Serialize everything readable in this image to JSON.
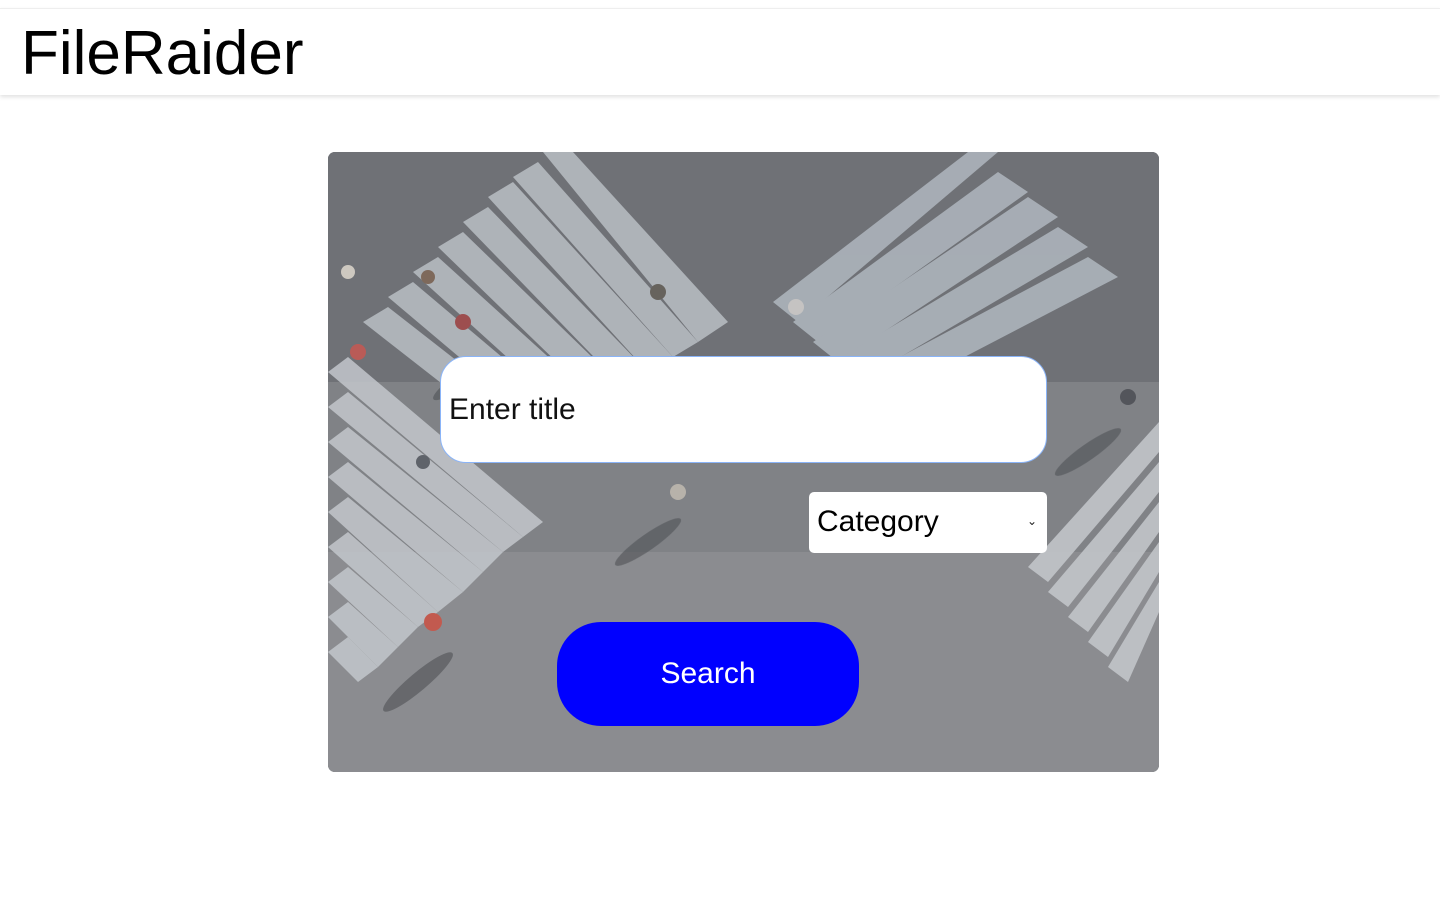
{
  "app": {
    "brand": "FileRaider"
  },
  "search": {
    "title_placeholder": "Enter title",
    "title_value": "",
    "category_label": "Category",
    "category_chevron": "⌄",
    "button_label": "Search"
  },
  "hero": {
    "background_image": "aerial view of pedestrian crosswalk"
  },
  "colors": {
    "accent": "#0000ff",
    "header_bg": "#ffffff",
    "button_text": "#ffffff"
  }
}
